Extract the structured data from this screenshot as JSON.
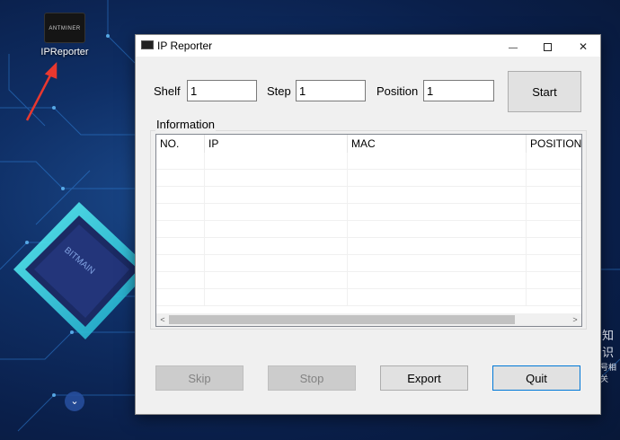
{
  "desktop": {
    "icon_label": "IPReporter",
    "icon_inner_text": "ANTMINER",
    "chip_text": "BITMAIN",
    "side_text_1": "知识",
    "side_text_2": "号相关"
  },
  "window": {
    "title": "IP Reporter",
    "controls": {
      "minimize": "—",
      "close": "✕"
    }
  },
  "form": {
    "shelf_label": "Shelf",
    "shelf_value": "1",
    "step_label": "Step",
    "step_value": "1",
    "position_label": "Position",
    "position_value": "1",
    "start_label": "Start"
  },
  "information": {
    "legend": "Information",
    "columns": [
      "NO.",
      "IP",
      "MAC",
      "POSITION"
    ]
  },
  "buttons": {
    "skip_label": "Skip",
    "stop_label": "Stop",
    "export_label": "Export",
    "quit_label": "Quit"
  },
  "colors": {
    "annotation_arrow": "#e8382f",
    "focus_border": "#0078d7",
    "desktop_glow": "#39e6e6"
  },
  "icons": {
    "minimize": "minimize-icon",
    "maximize": "maximize-icon",
    "close": "close-icon",
    "scroll_left": "chevron-left-icon",
    "scroll_right": "chevron-right-icon",
    "desktop_chevron": "chevron-down-icon"
  }
}
